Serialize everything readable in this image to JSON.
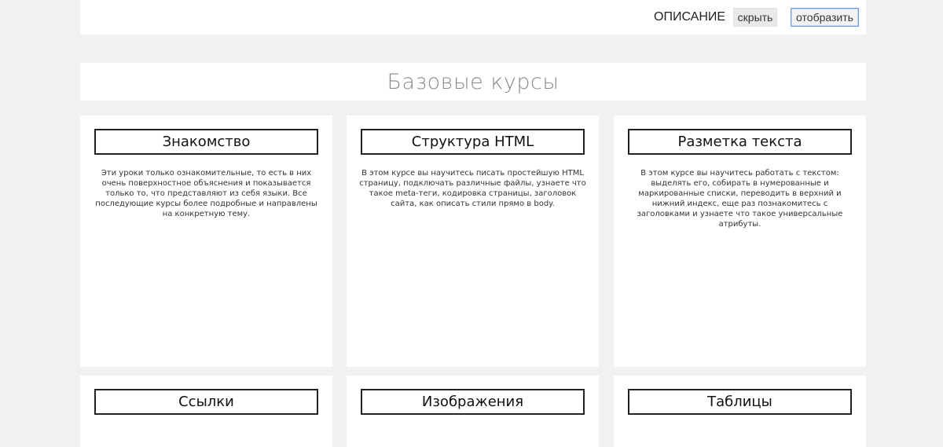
{
  "header": {
    "label": "ОПИСАНИЕ",
    "hide_button": "скрыть",
    "show_button": "отобразить"
  },
  "section": {
    "title": "Базовые курсы"
  },
  "cards": [
    {
      "title": "Знакомство",
      "text": "Эти уроки только ознакомительные, то есть в них очень поверхностное объяснения и показывается только то, что представляют из себя языки. Все последующие курсы более подробные и направлены на конкретную тему."
    },
    {
      "title": "Структура HTML",
      "text": "В этом курсе вы научитесь писать простейшую HTML страницу, подключать различные файлы, узнаете что такое meta-теги, кодировка страницы, заголовок сайта, как описать стили прямо в body."
    },
    {
      "title": "Разметка текста",
      "text": "В этом курсе вы научитесь работать с текстом: выделять его, собирать в нумерованные и маркированные списки, переводить в верхний и нижний индекс, еще раз познакомитесь с заголовками и узнаете что такое универсальные атрибуты."
    },
    {
      "title": "Ссылки"
    },
    {
      "title": "Изображения"
    },
    {
      "title": "Таблицы"
    }
  ]
}
